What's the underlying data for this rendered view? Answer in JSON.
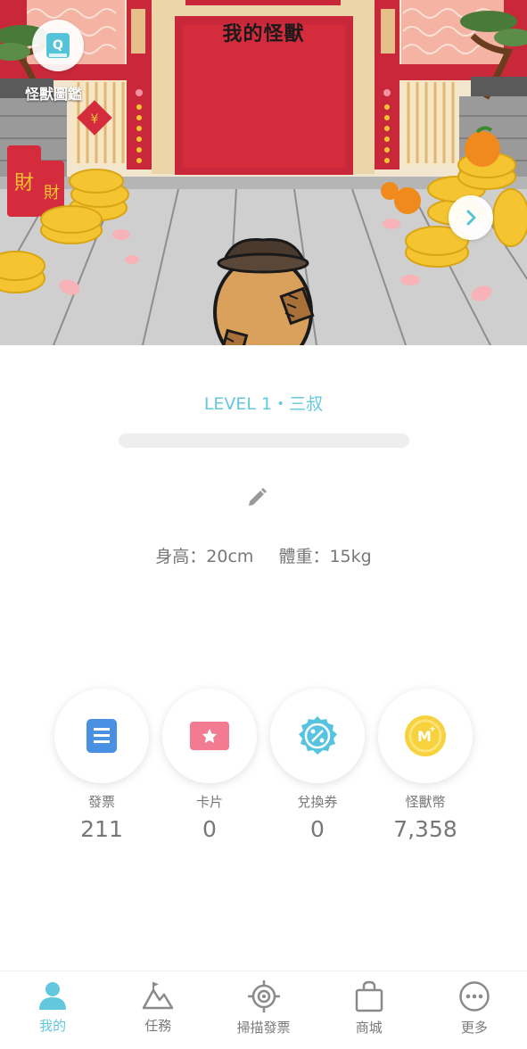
{
  "header": {
    "title": "我的怪獸",
    "book_label": "怪獸圖鑑",
    "book_icon_letter": "Q"
  },
  "profile": {
    "level": "LEVEL 1・三叔",
    "progress": 0,
    "height_text": "身高：20cm",
    "weight_text": "體重：15kg"
  },
  "assets": [
    {
      "label": "發票",
      "value": "211",
      "icon": "invoice-icon",
      "color": "#4a90e2"
    },
    {
      "label": "卡片",
      "value": "0",
      "icon": "card-icon",
      "color": "#f27b92"
    },
    {
      "label": "兌換券",
      "value": "0",
      "icon": "coupon-icon",
      "color": "#56c4e0"
    },
    {
      "label": "怪獸幣",
      "value": "7,358",
      "icon": "monster-coin-icon",
      "color": "#f7d23c"
    }
  ],
  "coin_letter": "M",
  "nav": [
    {
      "label": "我的",
      "icon": "person-icon",
      "active": true
    },
    {
      "label": "任務",
      "icon": "mountain-icon",
      "active": false
    },
    {
      "label": "掃描發票",
      "icon": "scan-target-icon",
      "active": false
    },
    {
      "label": "商城",
      "icon": "shopping-bag-icon",
      "active": false
    },
    {
      "label": "更多",
      "icon": "more-icon",
      "active": false
    }
  ],
  "colors": {
    "accent": "#63c8dd",
    "temple_red": "#d42b3d",
    "gold": "#f5c531"
  }
}
